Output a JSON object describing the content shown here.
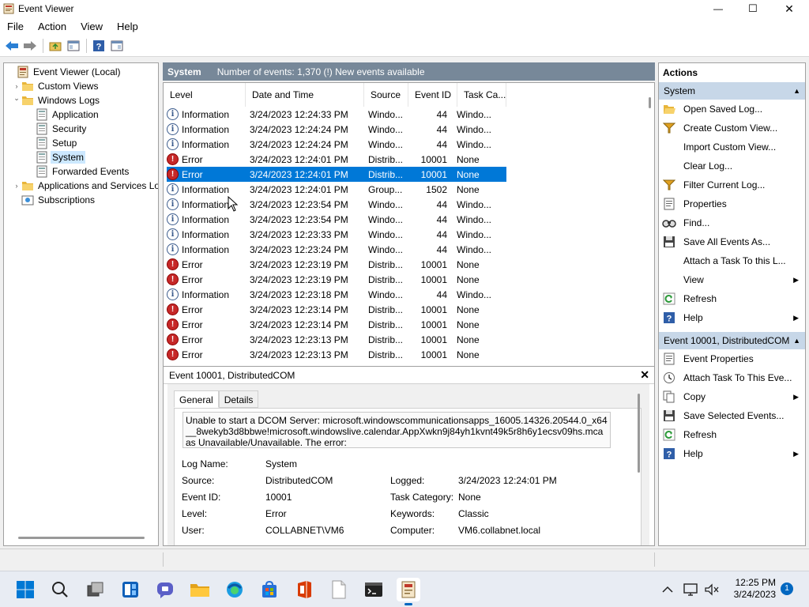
{
  "window": {
    "title": "Event Viewer",
    "controls": {
      "minimize": "—",
      "maximize": "☐",
      "close": "✕"
    }
  },
  "menu": [
    "File",
    "Action",
    "View",
    "Help"
  ],
  "tree": [
    {
      "label": "Event Viewer (Local)",
      "icon": "event-viewer-icon",
      "arrow": "",
      "depth": 0
    },
    {
      "label": "Custom Views",
      "icon": "folder-icon",
      "arrow": "›",
      "depth": 1
    },
    {
      "label": "Windows Logs",
      "icon": "folder-icon",
      "arrow": "⌄",
      "depth": 1
    },
    {
      "label": "Application",
      "icon": "log-icon",
      "arrow": "",
      "depth": 2
    },
    {
      "label": "Security",
      "icon": "log-icon",
      "arrow": "",
      "depth": 2
    },
    {
      "label": "Setup",
      "icon": "log-icon",
      "arrow": "",
      "depth": 2
    },
    {
      "label": "System",
      "icon": "log-icon",
      "arrow": "",
      "depth": 2,
      "selected": true
    },
    {
      "label": "Forwarded Events",
      "icon": "log-icon",
      "arrow": "",
      "depth": 2
    },
    {
      "label": "Applications and Services Lo",
      "icon": "folder-icon",
      "arrow": "›",
      "depth": 1
    },
    {
      "label": "Subscriptions",
      "icon": "subscriptions-icon",
      "arrow": "",
      "depth": 1
    }
  ],
  "list": {
    "name": "System",
    "count": "Number of events: 1,370 (!) New events available",
    "columns": [
      "Level",
      "Date and Time",
      "Source",
      "Event ID",
      "Task Ca..."
    ],
    "rows": [
      {
        "level": "Information",
        "type": "info",
        "date": "3/24/2023 12:24:33 PM",
        "source": "Windo...",
        "id": "44",
        "task": "Windo..."
      },
      {
        "level": "Information",
        "type": "info",
        "date": "3/24/2023 12:24:24 PM",
        "source": "Windo...",
        "id": "44",
        "task": "Windo..."
      },
      {
        "level": "Information",
        "type": "info",
        "date": "3/24/2023 12:24:24 PM",
        "source": "Windo...",
        "id": "44",
        "task": "Windo..."
      },
      {
        "level": "Error",
        "type": "err",
        "date": "3/24/2023 12:24:01 PM",
        "source": "Distrib...",
        "id": "10001",
        "task": "None"
      },
      {
        "level": "Error",
        "type": "err",
        "date": "3/24/2023 12:24:01 PM",
        "source": "Distrib...",
        "id": "10001",
        "task": "None",
        "selected": true
      },
      {
        "level": "Information",
        "type": "info",
        "date": "3/24/2023 12:24:01 PM",
        "source": "Group...",
        "id": "1502",
        "task": "None"
      },
      {
        "level": "Information",
        "type": "info",
        "date": "3/24/2023 12:23:54 PM",
        "source": "Windo...",
        "id": "44",
        "task": "Windo..."
      },
      {
        "level": "Information",
        "type": "info",
        "date": "3/24/2023 12:23:54 PM",
        "source": "Windo...",
        "id": "44",
        "task": "Windo..."
      },
      {
        "level": "Information",
        "type": "info",
        "date": "3/24/2023 12:23:33 PM",
        "source": "Windo...",
        "id": "44",
        "task": "Windo..."
      },
      {
        "level": "Information",
        "type": "info",
        "date": "3/24/2023 12:23:24 PM",
        "source": "Windo...",
        "id": "44",
        "task": "Windo..."
      },
      {
        "level": "Error",
        "type": "err",
        "date": "3/24/2023 12:23:19 PM",
        "source": "Distrib...",
        "id": "10001",
        "task": "None"
      },
      {
        "level": "Error",
        "type": "err",
        "date": "3/24/2023 12:23:19 PM",
        "source": "Distrib...",
        "id": "10001",
        "task": "None"
      },
      {
        "level": "Information",
        "type": "info",
        "date": "3/24/2023 12:23:18 PM",
        "source": "Windo...",
        "id": "44",
        "task": "Windo..."
      },
      {
        "level": "Error",
        "type": "err",
        "date": "3/24/2023 12:23:14 PM",
        "source": "Distrib...",
        "id": "10001",
        "task": "None"
      },
      {
        "level": "Error",
        "type": "err",
        "date": "3/24/2023 12:23:14 PM",
        "source": "Distrib...",
        "id": "10001",
        "task": "None"
      },
      {
        "level": "Error",
        "type": "err",
        "date": "3/24/2023 12:23:13 PM",
        "source": "Distrib...",
        "id": "10001",
        "task": "None"
      },
      {
        "level": "Error",
        "type": "err",
        "date": "3/24/2023 12:23:13 PM",
        "source": "Distrib...",
        "id": "10001",
        "task": "None"
      }
    ]
  },
  "detail": {
    "title": "Event 10001, DistributedCOM",
    "tabs": [
      "General",
      "Details"
    ],
    "message": [
      "Unable to start a DCOM Server: microsoft.windowscommunicationsapps_16005.14326.20544.0_x64",
      "__8wekyb3d8bbwe!microsoft.windowslive.calendar.AppXwkn9j84yh1kvnt49k5r8h6y1ecsv09hs.mca",
      "as Unavailable/Unavailable. The error:"
    ],
    "fields": {
      "log_name_label": "Log Name:",
      "log_name": "System",
      "source_label": "Source:",
      "source": "DistributedCOM",
      "logged_label": "Logged:",
      "logged": "3/24/2023 12:24:01 PM",
      "event_id_label": "Event ID:",
      "event_id": "10001",
      "task_label": "Task Category:",
      "task": "None",
      "level_label": "Level:",
      "level": "Error",
      "keywords_label": "Keywords:",
      "keywords": "Classic",
      "user_label": "User:",
      "user": "COLLABNET\\VM6",
      "computer_label": "Computer:",
      "computer": "VM6.collabnet.local"
    }
  },
  "actions": {
    "header": "Actions",
    "section1": {
      "title": "System",
      "items": [
        {
          "label": "Open Saved Log...",
          "icon": "open-folder-icon"
        },
        {
          "label": "Create Custom View...",
          "icon": "filter-icon"
        },
        {
          "label": "Import Custom View...",
          "icon": ""
        },
        {
          "label": "Clear Log...",
          "icon": ""
        },
        {
          "label": "Filter Current Log...",
          "icon": "filter-icon"
        },
        {
          "label": "Properties",
          "icon": "properties-icon"
        },
        {
          "label": "Find...",
          "icon": "find-icon"
        },
        {
          "label": "Save All Events As...",
          "icon": "save-icon"
        },
        {
          "label": "Attach a Task To this L...",
          "icon": ""
        },
        {
          "label": "View",
          "icon": "",
          "sub": true
        },
        {
          "label": "Refresh",
          "icon": "refresh-icon"
        },
        {
          "label": "Help",
          "icon": "help-icon",
          "sub": true
        }
      ]
    },
    "section2": {
      "title": "Event 10001, DistributedCOM",
      "items": [
        {
          "label": "Event Properties",
          "icon": "properties-icon"
        },
        {
          "label": "Attach Task To This Eve...",
          "icon": "task-icon"
        },
        {
          "label": "Copy",
          "icon": "copy-icon",
          "sub": true
        },
        {
          "label": "Save Selected Events...",
          "icon": "save-icon"
        },
        {
          "label": "Refresh",
          "icon": "refresh-icon"
        },
        {
          "label": "Help",
          "icon": "help-icon",
          "sub": true
        }
      ]
    }
  },
  "taskbar": {
    "time": "12:25 PM",
    "date": "3/24/2023",
    "notifications": "1"
  },
  "colors": {
    "selection": "#0078d7",
    "list_header": "#778899",
    "section_header": "#c7d7e8",
    "error": "#c62828",
    "info": "#3b5b8c"
  }
}
